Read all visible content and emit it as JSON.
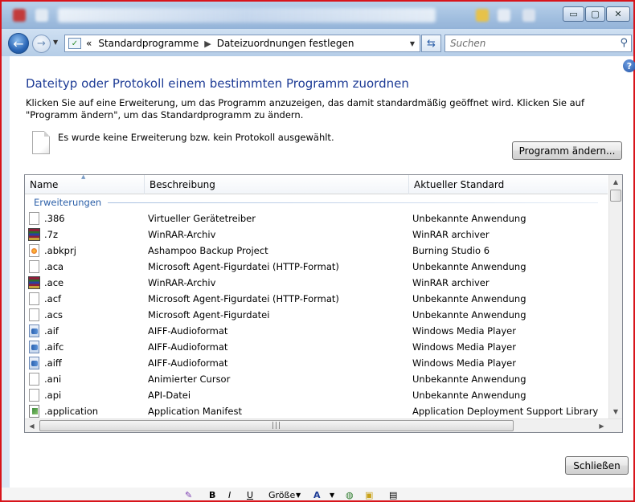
{
  "window": {
    "buttons": {
      "minimize": "▭",
      "maximize": "▢",
      "close": "✕"
    }
  },
  "nav": {
    "breadcrumb_prefix": "«",
    "breadcrumbs": [
      "Standardprogramme",
      "Dateizuordnungen festlegen"
    ],
    "search_placeholder": "Suchen"
  },
  "page": {
    "help": "?",
    "title": "Dateityp oder Protokoll einem bestimmten Programm zuordnen",
    "description": "Klicken Sie auf eine Erweiterung, um das Programm anzuzeigen, das damit standardmäßig geöffnet wird. Klicken Sie auf \"Programm ändern\", um das Standardprogramm zu ändern.",
    "no_selection": "Es wurde keine Erweiterung bzw. kein Protokoll ausgewählt.",
    "change_button": "Programm ändern...",
    "close_button": "Schließen"
  },
  "list": {
    "columns": [
      "Name",
      "Beschreibung",
      "Aktueller Standard"
    ],
    "group": "Erweiterungen",
    "rows": [
      {
        "icon": "blank",
        "name": ".386",
        "desc": "Virtueller Gerätetreiber",
        "default": "Unbekannte Anwendung"
      },
      {
        "icon": "rar",
        "name": ".7z",
        "desc": "WinRAR-Archiv",
        "default": "WinRAR archiver"
      },
      {
        "icon": "abk",
        "name": ".abkprj",
        "desc": "Ashampoo Backup Project",
        "default": "Burning Studio 6"
      },
      {
        "icon": "blank",
        "name": ".aca",
        "desc": "Microsoft Agent-Figurdatei (HTTP-Format)",
        "default": "Unbekannte Anwendung"
      },
      {
        "icon": "rar",
        "name": ".ace",
        "desc": "WinRAR-Archiv",
        "default": "WinRAR archiver"
      },
      {
        "icon": "blank",
        "name": ".acf",
        "desc": "Microsoft Agent-Figurdatei (HTTP-Format)",
        "default": "Unbekannte Anwendung"
      },
      {
        "icon": "blank",
        "name": ".acs",
        "desc": "Microsoft Agent-Figurdatei",
        "default": "Unbekannte Anwendung"
      },
      {
        "icon": "media",
        "name": ".aif",
        "desc": "AIFF-Audioformat",
        "default": "Windows Media Player"
      },
      {
        "icon": "media",
        "name": ".aifc",
        "desc": "AIFF-Audioformat",
        "default": "Windows Media Player"
      },
      {
        "icon": "media",
        "name": ".aiff",
        "desc": "AIFF-Audioformat",
        "default": "Windows Media Player"
      },
      {
        "icon": "blank",
        "name": ".ani",
        "desc": "Animierter Cursor",
        "default": "Unbekannte Anwendung"
      },
      {
        "icon": "blank",
        "name": ".api",
        "desc": "API-Datei",
        "default": "Unbekannte Anwendung"
      },
      {
        "icon": "app",
        "name": ".application",
        "desc": "Application Manifest",
        "default": "Application Deployment Support Library"
      }
    ]
  },
  "toolbar": {
    "bold": "B",
    "italic": "I",
    "underline": "U",
    "size_label": "Größe"
  }
}
